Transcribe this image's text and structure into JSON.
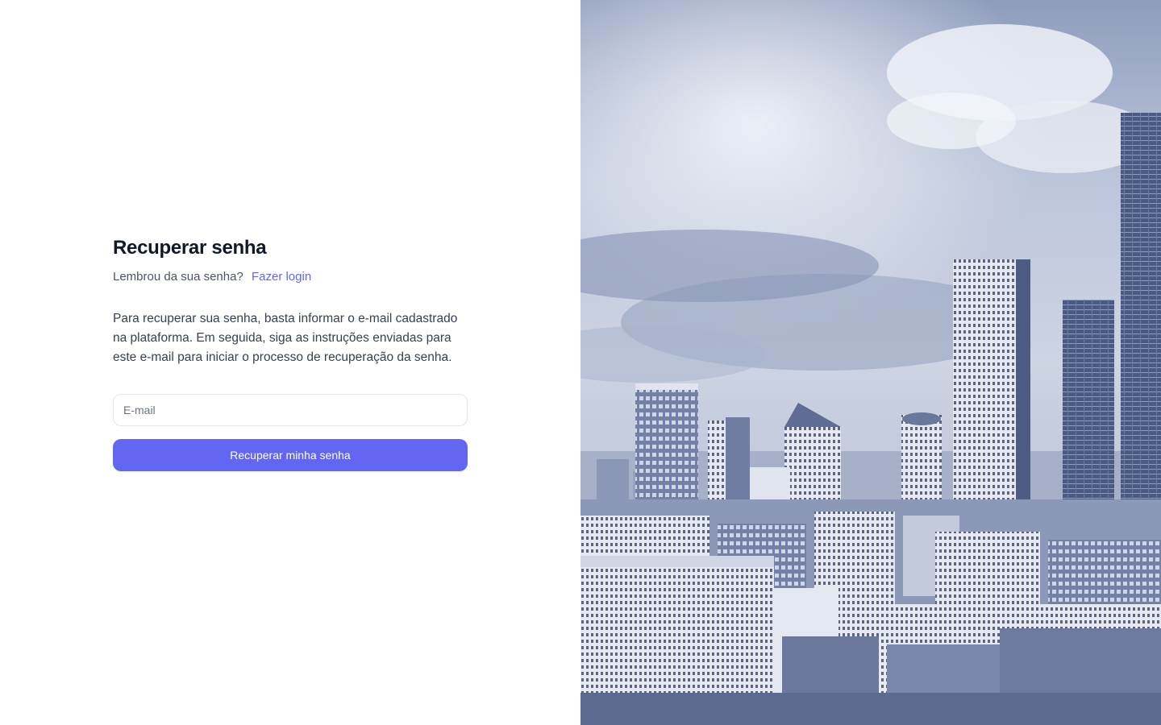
{
  "form": {
    "title": "Recuperar senha",
    "remember_text": "Lembrou da sua senha?",
    "login_link": "Fazer login",
    "description": "Para recuperar sua senha, basta informar o e-mail cadastrado na plataforma. Em seguida, siga as instruções enviadas para este e-mail para iniciar o processo de recuperação da senha.",
    "email_placeholder": "E-mail",
    "email_value": "",
    "submit_label": "Recuperar minha senha"
  },
  "colors": {
    "accent": "#6366f1",
    "title": "#111827",
    "body_text": "#374151",
    "muted_text": "#4b5563",
    "input_border": "#e5e7eb",
    "photo_tint": "#7f8fb5"
  },
  "hero_image": {
    "subject": "city-skyline-photo"
  }
}
